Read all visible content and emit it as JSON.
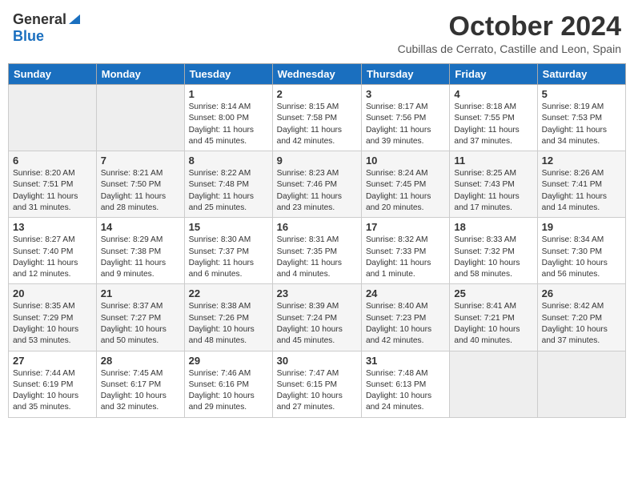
{
  "header": {
    "logo_general": "General",
    "logo_blue": "Blue",
    "month_title": "October 2024",
    "subtitle": "Cubillas de Cerrato, Castille and Leon, Spain"
  },
  "days_of_week": [
    "Sunday",
    "Monday",
    "Tuesday",
    "Wednesday",
    "Thursday",
    "Friday",
    "Saturday"
  ],
  "weeks": [
    [
      {
        "day": "",
        "info": ""
      },
      {
        "day": "",
        "info": ""
      },
      {
        "day": "1",
        "info": "Sunrise: 8:14 AM\nSunset: 8:00 PM\nDaylight: 11 hours and 45 minutes."
      },
      {
        "day": "2",
        "info": "Sunrise: 8:15 AM\nSunset: 7:58 PM\nDaylight: 11 hours and 42 minutes."
      },
      {
        "day": "3",
        "info": "Sunrise: 8:17 AM\nSunset: 7:56 PM\nDaylight: 11 hours and 39 minutes."
      },
      {
        "day": "4",
        "info": "Sunrise: 8:18 AM\nSunset: 7:55 PM\nDaylight: 11 hours and 37 minutes."
      },
      {
        "day": "5",
        "info": "Sunrise: 8:19 AM\nSunset: 7:53 PM\nDaylight: 11 hours and 34 minutes."
      }
    ],
    [
      {
        "day": "6",
        "info": "Sunrise: 8:20 AM\nSunset: 7:51 PM\nDaylight: 11 hours and 31 minutes."
      },
      {
        "day": "7",
        "info": "Sunrise: 8:21 AM\nSunset: 7:50 PM\nDaylight: 11 hours and 28 minutes."
      },
      {
        "day": "8",
        "info": "Sunrise: 8:22 AM\nSunset: 7:48 PM\nDaylight: 11 hours and 25 minutes."
      },
      {
        "day": "9",
        "info": "Sunrise: 8:23 AM\nSunset: 7:46 PM\nDaylight: 11 hours and 23 minutes."
      },
      {
        "day": "10",
        "info": "Sunrise: 8:24 AM\nSunset: 7:45 PM\nDaylight: 11 hours and 20 minutes."
      },
      {
        "day": "11",
        "info": "Sunrise: 8:25 AM\nSunset: 7:43 PM\nDaylight: 11 hours and 17 minutes."
      },
      {
        "day": "12",
        "info": "Sunrise: 8:26 AM\nSunset: 7:41 PM\nDaylight: 11 hours and 14 minutes."
      }
    ],
    [
      {
        "day": "13",
        "info": "Sunrise: 8:27 AM\nSunset: 7:40 PM\nDaylight: 11 hours and 12 minutes."
      },
      {
        "day": "14",
        "info": "Sunrise: 8:29 AM\nSunset: 7:38 PM\nDaylight: 11 hours and 9 minutes."
      },
      {
        "day": "15",
        "info": "Sunrise: 8:30 AM\nSunset: 7:37 PM\nDaylight: 11 hours and 6 minutes."
      },
      {
        "day": "16",
        "info": "Sunrise: 8:31 AM\nSunset: 7:35 PM\nDaylight: 11 hours and 4 minutes."
      },
      {
        "day": "17",
        "info": "Sunrise: 8:32 AM\nSunset: 7:33 PM\nDaylight: 11 hours and 1 minute."
      },
      {
        "day": "18",
        "info": "Sunrise: 8:33 AM\nSunset: 7:32 PM\nDaylight: 10 hours and 58 minutes."
      },
      {
        "day": "19",
        "info": "Sunrise: 8:34 AM\nSunset: 7:30 PM\nDaylight: 10 hours and 56 minutes."
      }
    ],
    [
      {
        "day": "20",
        "info": "Sunrise: 8:35 AM\nSunset: 7:29 PM\nDaylight: 10 hours and 53 minutes."
      },
      {
        "day": "21",
        "info": "Sunrise: 8:37 AM\nSunset: 7:27 PM\nDaylight: 10 hours and 50 minutes."
      },
      {
        "day": "22",
        "info": "Sunrise: 8:38 AM\nSunset: 7:26 PM\nDaylight: 10 hours and 48 minutes."
      },
      {
        "day": "23",
        "info": "Sunrise: 8:39 AM\nSunset: 7:24 PM\nDaylight: 10 hours and 45 minutes."
      },
      {
        "day": "24",
        "info": "Sunrise: 8:40 AM\nSunset: 7:23 PM\nDaylight: 10 hours and 42 minutes."
      },
      {
        "day": "25",
        "info": "Sunrise: 8:41 AM\nSunset: 7:21 PM\nDaylight: 10 hours and 40 minutes."
      },
      {
        "day": "26",
        "info": "Sunrise: 8:42 AM\nSunset: 7:20 PM\nDaylight: 10 hours and 37 minutes."
      }
    ],
    [
      {
        "day": "27",
        "info": "Sunrise: 7:44 AM\nSunset: 6:19 PM\nDaylight: 10 hours and 35 minutes."
      },
      {
        "day": "28",
        "info": "Sunrise: 7:45 AM\nSunset: 6:17 PM\nDaylight: 10 hours and 32 minutes."
      },
      {
        "day": "29",
        "info": "Sunrise: 7:46 AM\nSunset: 6:16 PM\nDaylight: 10 hours and 29 minutes."
      },
      {
        "day": "30",
        "info": "Sunrise: 7:47 AM\nSunset: 6:15 PM\nDaylight: 10 hours and 27 minutes."
      },
      {
        "day": "31",
        "info": "Sunrise: 7:48 AM\nSunset: 6:13 PM\nDaylight: 10 hours and 24 minutes."
      },
      {
        "day": "",
        "info": ""
      },
      {
        "day": "",
        "info": ""
      }
    ]
  ]
}
